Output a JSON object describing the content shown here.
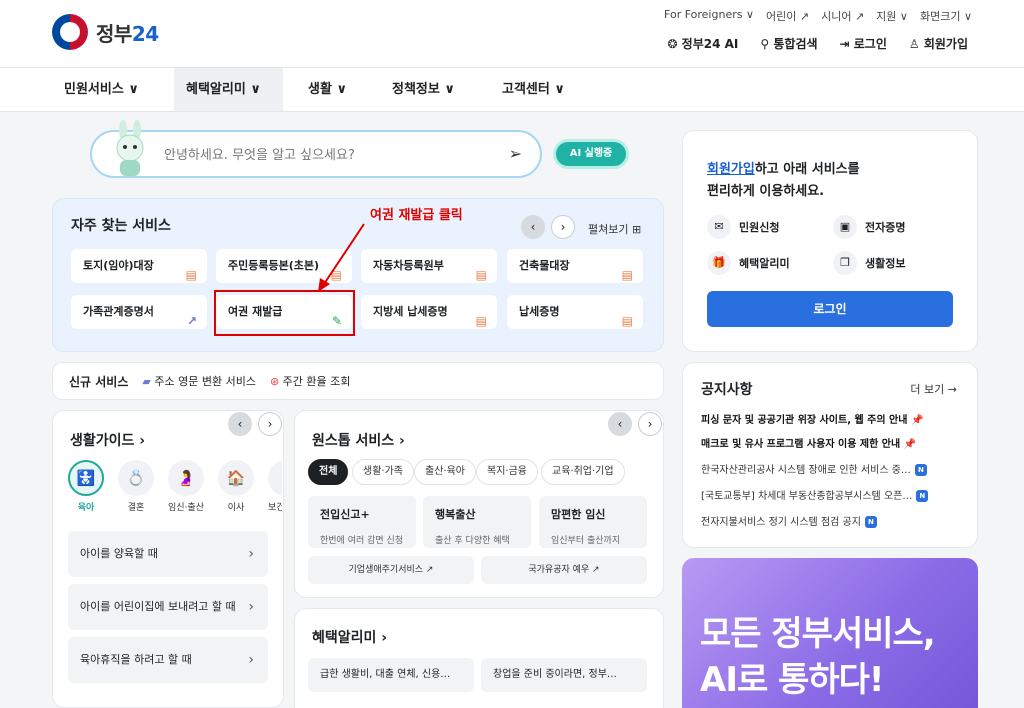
{
  "header": {
    "logo_text": "정부",
    "logo_num": "24",
    "utility": [
      "For Foreigners ∨",
      "어린이 ↗",
      "시니어 ↗",
      "지원 ∨",
      "화면크기 ∨"
    ],
    "actions": [
      "정부24 AI",
      "통합검색",
      "로그인",
      "회원가입"
    ]
  },
  "nav": [
    "민원서비스 ∨",
    "혜택알리미 ∨",
    "생활 ∨",
    "정책정보 ∨",
    "고객센터 ∨"
  ],
  "search": {
    "placeholder": "안녕하세요. 무엇을 알고 싶으세요?",
    "ai_label": "AI 실행중"
  },
  "frequent": {
    "title": "자주 찾는 서비스",
    "spread_label": "펼쳐보기 ⊞",
    "items": [
      "토지(임야)대장",
      "주민등록등본(초본)",
      "자동차등록원부",
      "건축물대장",
      "가족관계증명서",
      "여권 재발급",
      "지방세 납세증명",
      "납세증명"
    ]
  },
  "annotation": {
    "text": "여권 재발급 클릭"
  },
  "new_services": {
    "label": "신규 서비스",
    "items": [
      "주소 영문 변환 서비스",
      "주간 환율 조회"
    ]
  },
  "life_guide": {
    "title": "생활가이드 ›",
    "icons": [
      "육아",
      "결혼",
      "임신·출산",
      "이사",
      "보건"
    ],
    "list": [
      "아이를 양육할 때",
      "아이를 어린이집에 보내려고 할 때",
      "육아휴직을 하려고 할 때"
    ]
  },
  "onestop": {
    "title": "원스톱 서비스 ›",
    "chips": [
      "전체",
      "생활·가족",
      "출산·육아",
      "복지·금융",
      "교육·취업·기업"
    ],
    "tiles": [
      {
        "title": "전입신고+",
        "desc": "한번에 여러 감면 신청"
      },
      {
        "title": "행복출산",
        "desc": "출산 후 다양한 혜택"
      },
      {
        "title": "맘편한 임신",
        "desc": "임신부터 출산까지"
      }
    ],
    "links": [
      "기업생애주기서비스 ↗",
      "국가유공자 예우 ↗"
    ]
  },
  "benefit": {
    "title": "혜택알리미 ›",
    "boxes": [
      "급한 생활비, 대출 연체, 신용…",
      "창업을 준비 중이라면, 정부…"
    ]
  },
  "login_card": {
    "promo_link": "회원가입",
    "promo_rest": "하고 아래 서비스를",
    "promo_line2": "편리하게 이용하세요.",
    "quick": [
      "민원신청",
      "전자증명",
      "혜택알리미",
      "생활정보"
    ],
    "login_button": "로그인"
  },
  "notice": {
    "title": "공지사항",
    "more": "더 보기 →",
    "items": [
      "피싱 문자 및 공공기관 위장 사이트, 웹 주의 안내",
      "매크로 및 유사 프로그램 사용자 이용 제한 안내",
      "한국자산관리공사 시스템 장애로 인한 서비스 중…",
      "[국토교통부] 차세대 부동산종합공부시스템 오픈…",
      "전자지불서비스 정기 시스템 점검 공지"
    ]
  },
  "banner": {
    "line1": "모든 정부서비스,",
    "line2": "AI로 통하다!"
  }
}
